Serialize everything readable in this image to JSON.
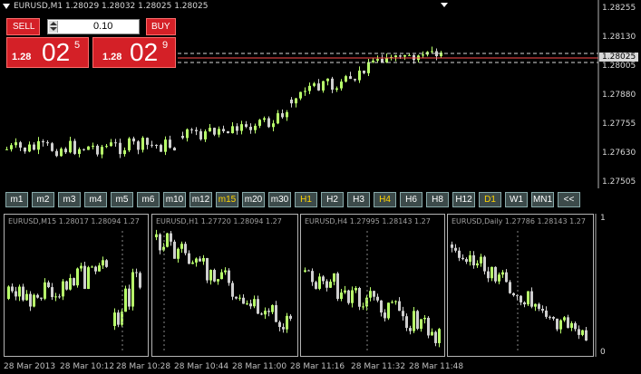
{
  "chart": {
    "title": "EURUSD,M1  1.28029 1.28032 1.28025 1.28025",
    "current_price": "1.28025",
    "price_ticks": [
      "1.28255",
      "1.28130",
      "1.28005",
      "1.27880",
      "1.27755",
      "1.27630",
      "1.27505"
    ]
  },
  "trade_panel": {
    "sell_label": "SELL",
    "buy_label": "BUY",
    "volume": "0.10",
    "sell_small": "1.28",
    "sell_big": "02",
    "sell_sup": "5",
    "buy_small": "1.28",
    "buy_big": "02",
    "buy_sup": "9"
  },
  "timeframes": [
    {
      "label": "m1",
      "active": false
    },
    {
      "label": "m2",
      "active": false
    },
    {
      "label": "m3",
      "active": false
    },
    {
      "label": "m4",
      "active": false
    },
    {
      "label": "m5",
      "active": false
    },
    {
      "label": "m6",
      "active": false
    },
    {
      "label": "m10",
      "active": false
    },
    {
      "label": "m12",
      "active": false
    },
    {
      "label": "m15",
      "active": true
    },
    {
      "label": "m20",
      "active": false
    },
    {
      "label": "m30",
      "active": false
    },
    {
      "label": "H1",
      "active": true
    },
    {
      "label": "H2",
      "active": false
    },
    {
      "label": "H3",
      "active": false
    },
    {
      "label": "H4",
      "active": true
    },
    {
      "label": "H6",
      "active": false
    },
    {
      "label": "H8",
      "active": false
    },
    {
      "label": "H12",
      "active": false
    },
    {
      "label": "D1",
      "active": true
    },
    {
      "label": "W1",
      "active": false
    },
    {
      "label": "MN1",
      "active": false
    },
    {
      "label": "<<",
      "active": false
    }
  ],
  "panels": [
    {
      "title": "EURUSD,M15  1.28017 1.28094 1.27"
    },
    {
      "title": "EURUSD,H1  1.27720 1.28094 1.27"
    },
    {
      "title": "EURUSD,H4  1.27995 1.28143 1.27"
    },
    {
      "title": "EURUSD,Daily  1.27786 1.28143 1.27"
    }
  ],
  "sub_axis": {
    "top": "1",
    "bottom": "0"
  },
  "time_labels": [
    "28 Mar 2013",
    "28 Mar 10:12",
    "28 Mar 10:28",
    "28 Mar 10:44",
    "28 Mar 11:00",
    "28 Mar 11:16",
    "28 Mar 11:32",
    "28 Mar 11:48"
  ],
  "colors": {
    "bull": "#b8ff6a",
    "bear": "#cfcfcf",
    "sell_bg": "#d42027",
    "active_tf": "#ffd400"
  }
}
